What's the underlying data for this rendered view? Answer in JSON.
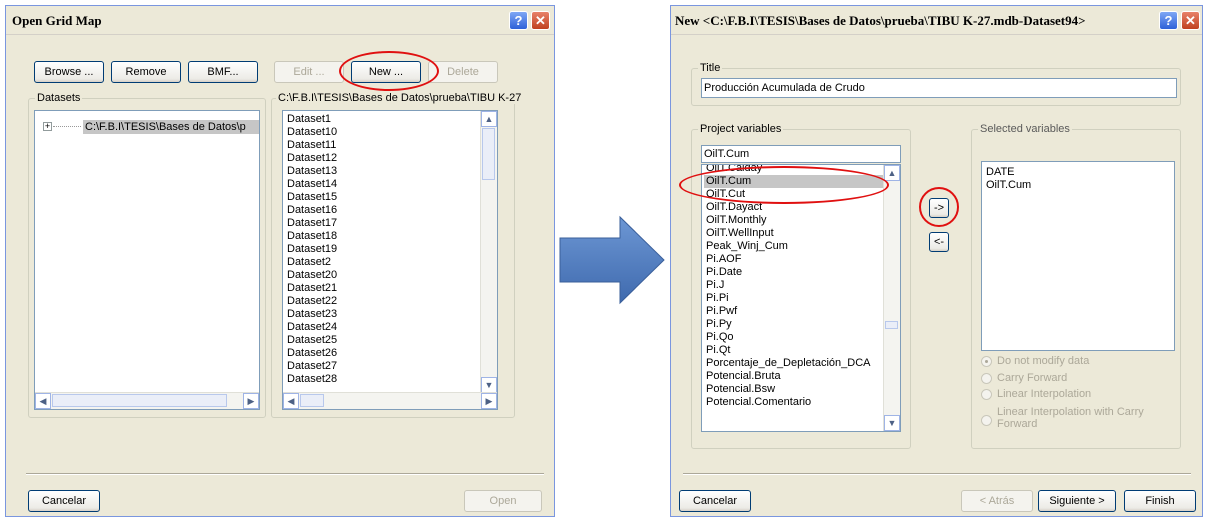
{
  "left_dialog": {
    "title": "Open Grid Map",
    "browse_label": "Browse ...",
    "remove_label": "Remove",
    "bmf_label": "BMF...",
    "edit_label": "Edit ...",
    "new_label": "New ...",
    "delete_label": "Delete",
    "datasets_label": "Datasets",
    "tree_expander": "+",
    "tree_item": "C:\\F.B.I\\TESIS\\Bases de Datos\\p",
    "path_label": "C:\\F.B.I\\TESIS\\Bases de Datos\\prueba\\TIBU K-27",
    "dataset_list": [
      "Dataset1",
      "Dataset10",
      "Dataset11",
      "Dataset12",
      "Dataset13",
      "Dataset14",
      "Dataset15",
      "Dataset16",
      "Dataset17",
      "Dataset18",
      "Dataset19",
      "Dataset2",
      "Dataset20",
      "Dataset21",
      "Dataset22",
      "Dataset23",
      "Dataset24",
      "Dataset25",
      "Dataset26",
      "Dataset27",
      "Dataset28"
    ],
    "cancel_label": "Cancelar",
    "open_label": "Open"
  },
  "right_dialog": {
    "title": "New <C:\\F.B.I\\TESIS\\Bases de Datos\\prueba\\TIBU K-27.mdb-Dataset94>",
    "title_group_label": "Title",
    "title_value": "Producción Acumulada de Crudo",
    "project_vars_label": "Project variables",
    "filter_value": "OilT.Cum",
    "project_vars": [
      "OilT.Calday",
      "OilT.Cum",
      "OilT.Cut",
      "OilT.Dayact",
      "OilT.Monthly",
      "OilT.WellInput",
      "Peak_Winj_Cum",
      "Pi.AOF",
      "Pi.Date",
      "Pi.J",
      "Pi.Pi",
      "Pi.Pwf",
      "Pi.Py",
      "Pi.Qo",
      "Pi.Qt",
      "Porcentaje_de_Depletación_DCA",
      "Potencial.Bruta",
      "Potencial.Bsw",
      "Potencial.Comentario"
    ],
    "selected_project_var": "OilT.Cum",
    "add_label": "->",
    "remove_label": "<-",
    "selected_vars_label": "Selected variables",
    "selected_vars": [
      "DATE",
      "OilT.Cum"
    ],
    "options": [
      "Do not modify data",
      "Carry Forward",
      "Linear Interpolation",
      "Linear Interpolation with Carry Forward"
    ],
    "cancel_label": "Cancelar",
    "back_label": "< Atrás",
    "next_label": "Siguiente >",
    "finish_label": "Finish"
  },
  "colors": {
    "dialog_bg": "#ece9d8",
    "highlight_ring": "#e01010",
    "arrow": "#4f81bd",
    "selection": "#c6c6c6"
  },
  "icons": {
    "help": "?",
    "close": "X",
    "arrow": "right-arrow-icon"
  }
}
